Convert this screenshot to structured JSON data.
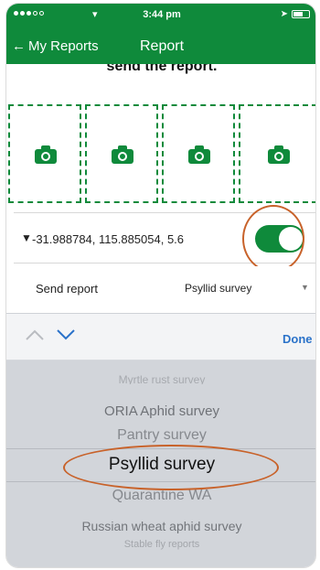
{
  "status_bar": {
    "time": "3:44 pm"
  },
  "nav": {
    "back_label": "My Reports",
    "title": "Report"
  },
  "header": {
    "text": "send the report."
  },
  "photos": {
    "count": 4,
    "icon": "camera-icon"
  },
  "location": {
    "coordinates": "-31.988784, 115.885054, 5.6",
    "toggle_on": true
  },
  "send_report": {
    "label": "Send report",
    "value": "Psyllid survey"
  },
  "toolbar": {
    "done_label": "Done"
  },
  "picker": {
    "options": [
      "Myrtle rust survey",
      "ORIA Aphid survey",
      "Pantry survey",
      "Psyllid survey",
      "Quarantine WA",
      "Russian wheat aphid survey",
      "Stable fly reports"
    ],
    "selected": "Psyllid survey"
  },
  "colors": {
    "brand_green": "#0f8a3b",
    "highlight_circle": "#c8622a",
    "done_blue": "#2a72c9"
  }
}
